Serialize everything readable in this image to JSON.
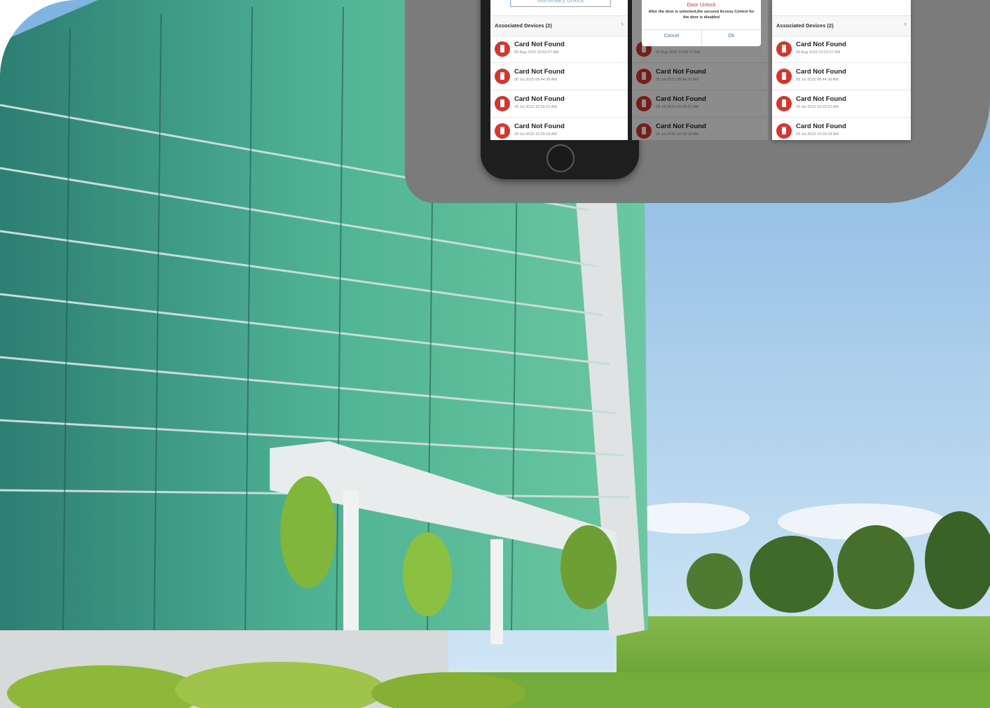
{
  "screens": {
    "left": {
      "unlock_button": "Momentary Unlock",
      "associated_label": "Associated Devices (2)",
      "chevron": "›",
      "events": [
        {
          "title": "Card Not Found",
          "time": "05 Aug 2015 10:53:27 AM"
        },
        {
          "title": "Card Not Found",
          "time": "30 Jul 2015 08:44:36 AM"
        },
        {
          "title": "Card Not Found",
          "time": "29 Jul 2015 10:29:22 AM"
        },
        {
          "title": "Card Not Found",
          "time": "29 Jul 2015 10:29:18 AM"
        }
      ]
    },
    "middle": {
      "dialog": {
        "title": "Door Unlock",
        "message": "After the door is unlocked,the secured Access Control for the door is disabled",
        "cancel": "Cancel",
        "ok": "Ok"
      },
      "events": [
        {
          "title": "Card Not Found",
          "time": "05 Aug 2015 10:53:27 AM"
        },
        {
          "title": "Card Not Found",
          "time": "30 Jul 2015 08:44:36 AM"
        },
        {
          "title": "Card Not Found",
          "time": "29 Jul 2015 10:29:22 AM"
        },
        {
          "title": "Card Not Found",
          "time": "29 Jul 2015 10:29:18 AM"
        }
      ]
    },
    "right": {
      "associated_label": "Associated Devices (2)",
      "chevron": "›",
      "events": [
        {
          "title": "Card Not Found",
          "time": "05 Aug 2015 10:53:27 AM"
        },
        {
          "title": "Card Not Found",
          "time": "30 Jul 2015 08:44:36 AM"
        },
        {
          "title": "Card Not Found",
          "time": "29 Jul 2015 10:29:22 AM"
        },
        {
          "title": "Card Not Found",
          "time": "29 Jul 2015 10:29:18 AM"
        }
      ]
    }
  },
  "colors": {
    "panel": "#7b7b7b",
    "alert_red": "#d9332b",
    "link_blue": "#2f79c8",
    "glass_green": "#3fa389",
    "sky": "#9ec8e8",
    "grass": "#6fa83a"
  }
}
